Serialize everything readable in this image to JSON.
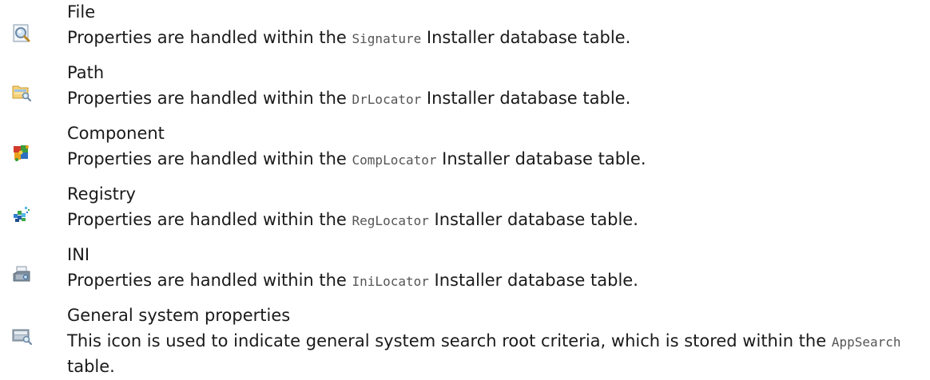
{
  "entries": [
    {
      "id": "file",
      "icon": "file-search-icon",
      "term": "File",
      "desc_before": "Properties are handled within the ",
      "code": "Signature",
      "desc_after": " Installer database table."
    },
    {
      "id": "path",
      "icon": "folder-search-icon",
      "term": "Path",
      "desc_before": "Properties are handled within the ",
      "code": "DrLocator",
      "desc_after": " Installer database table."
    },
    {
      "id": "component",
      "icon": "component-icon",
      "term": "Component",
      "desc_before": "Properties are handled within the ",
      "code": "CompLocator",
      "desc_after": " Installer database table."
    },
    {
      "id": "registry",
      "icon": "registry-icon",
      "term": "Registry",
      "desc_before": "Properties are handled within the ",
      "code": "RegLocator",
      "desc_after": " Installer database table."
    },
    {
      "id": "ini",
      "icon": "ini-file-icon",
      "term": "INI",
      "desc_before": "Properties are handled within the ",
      "code": "IniLocator",
      "desc_after": " Installer database table."
    },
    {
      "id": "general",
      "icon": "system-search-icon",
      "term": "General system properties",
      "desc_before": "This icon is used to indicate general system search root criteria, which is stored within the ",
      "code": "AppSearch",
      "desc_after": " table."
    }
  ]
}
